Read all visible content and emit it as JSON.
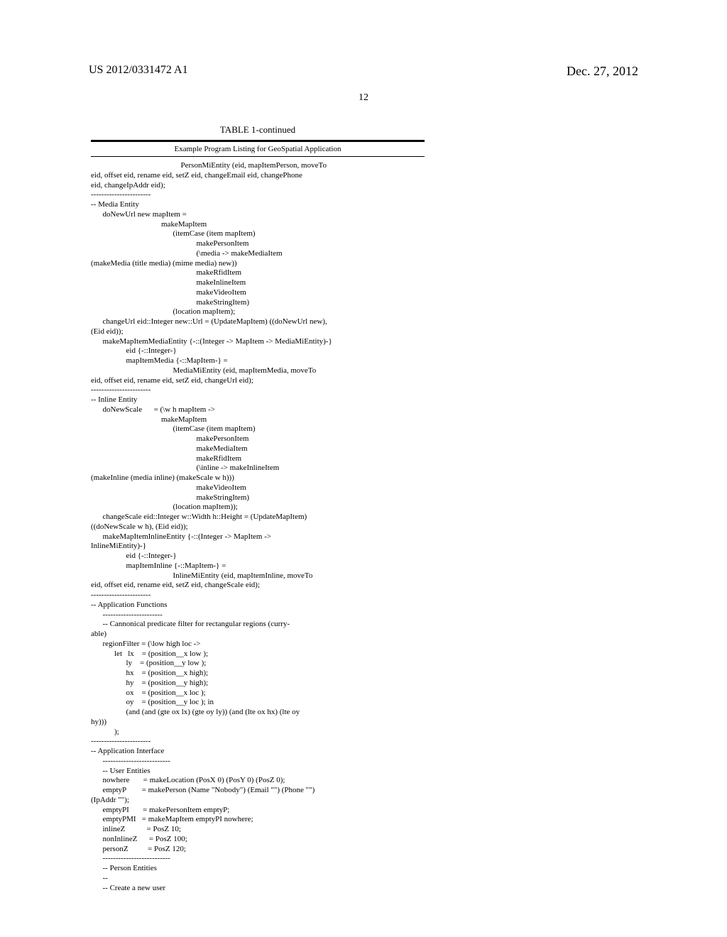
{
  "header": {
    "pubNumber": "US 2012/0331472 A1",
    "pubDate": "Dec. 27, 2012"
  },
  "pageNumber": "12",
  "table": {
    "title": "TABLE 1-continued",
    "caption": "Example Program Listing for GeoSpatial Application",
    "code": "                                              PersonMiEntity (eid, mapItemPerson, moveTo\neid, offset eid, rename eid, setZ eid, changeEmail eid, changePhone\neid, changeIpAddr eid);\n-----------------------\n-- Media Entity\n      doNewUrl new mapItem =\n                                    makeMapItem\n                                          (itemCase (item mapItem)\n                                                      makePersonItem\n                                                      (\\media -> makeMediaItem\n(makeMedia (title media) (mime media) new))\n                                                      makeRfidItem\n                                                      makeInlineItem\n                                                      makeVideoItem\n                                                      makeStringItem)\n                                          (location mapItem);\n      changeUrl eid::Integer new::Url = (UpdateMapItem) ((doNewUrl new),\n(Eid eid));\n      makeMapItemMediaEntity {-::(Integer -> MapItem -> MediaMiEntity)-}\n                  eid {-::Integer-}\n                  mapItemMedia {-::MapItem-} =\n                                          MediaMiEntity (eid, mapItemMedia, moveTo\neid, offset eid, rename eid, setZ eid, changeUrl eid);\n-----------------------\n-- Inline Entity\n      doNewScale      = (\\w h mapItem ->\n                                    makeMapItem\n                                          (itemCase (item mapItem)\n                                                      makePersonItem\n                                                      makeMediaItem\n                                                      makeRfidItem\n                                                      (\\inline -> makeInlineItem\n(makeInline (media inline) (makeScale w h)))\n                                                      makeVideoItem\n                                                      makeStringItem)\n                                          (location mapItem));\n      changeScale eid::Integer w::Width h::Height = (UpdateMapItem)\n((doNewScale w h), (Eid eid));\n      makeMapItemInlineEntity {-::(Integer -> MapItem ->\nInlineMiEntity)-}\n                  eid {-::Integer-}\n                  mapItemInline {-::MapItem-} =\n                                          InlineMiEntity (eid, mapItemInline, moveTo\neid, offset eid, rename eid, setZ eid, changeScale eid);\n-----------------------\n-- Application Functions\n      -----------------------\n      -- Cannonical predicate filter for rectangular regions (curry-\nable)\n      regionFilter = (\\low high loc ->\n            let   lx    = (position__x low );\n                  ly    = (position__y low );\n                  hx    = (position__x high);\n                  hy    = (position__y high);\n                  ox    = (position__x loc );\n                  oy    = (position__y loc ); in\n                  (and (and (gte ox lx) (gte oy ly)) (and (lte ox hx) (lte oy\nhy)))\n            );\n-----------------------\n-- Application Interface\n      --------------------------\n      -- User Entities\n      nowhere       = makeLocation (PosX 0) (PosY 0) (PosZ 0);\n      emptyP        = makePerson (Name \"Nobody\") (Email \"\") (Phone \"\")\n(IpAddr \"\");\n      emptyPI       = makePersonItem emptyP;\n      emptyPMI   = makeMapItem emptyPI nowhere;\n      inlineZ           = PosZ 10;\n      nonInlineZ      = PosZ 100;\n      personZ          = PosZ 120;\n      --------------------------\n      -- Person Entities\n      --\n      -- Create a new user"
  }
}
